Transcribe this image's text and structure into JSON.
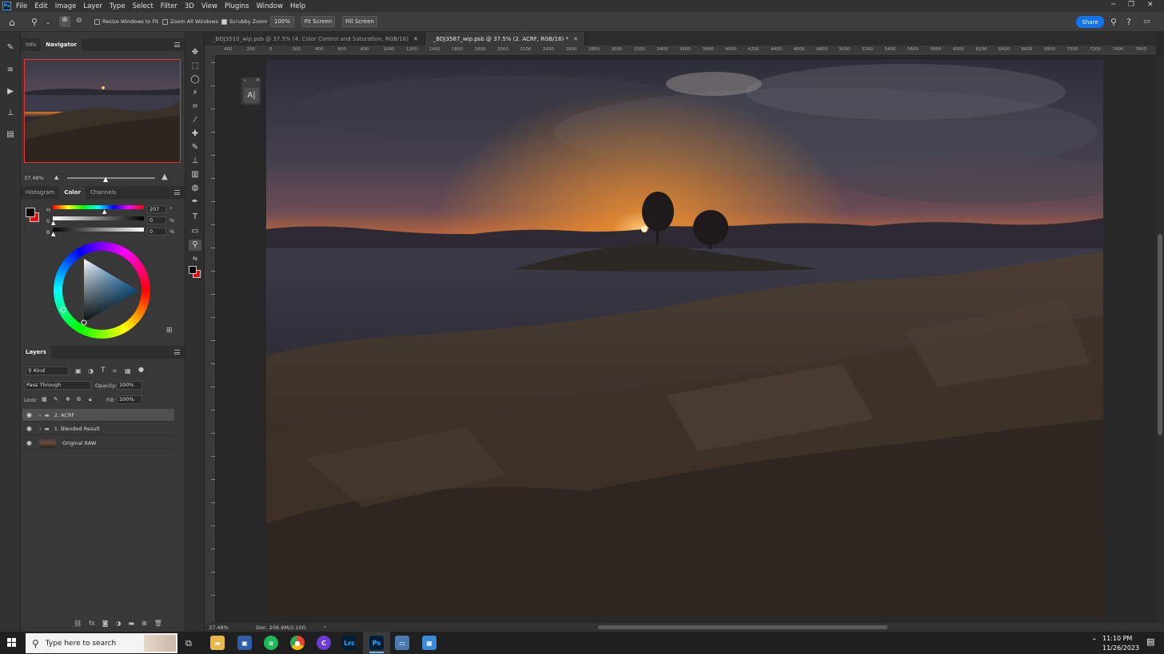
{
  "menubar": {
    "items": [
      "File",
      "Edit",
      "Image",
      "Layer",
      "Type",
      "Select",
      "Filter",
      "3D",
      "View",
      "Plugins",
      "Window",
      "Help"
    ],
    "app_icon_label": "Ps"
  },
  "options_bar": {
    "resize_windows_label": "Resize Windows to Fit",
    "zoom_all_label": "Zoom All Windows",
    "scrubby_zoom_label": "Scrubby Zoom",
    "zoom_value": "100%",
    "fit_screen_label": "Fit Screen",
    "fill_screen_label": "Fill Screen",
    "share_label": "Share"
  },
  "navigator": {
    "tabs": [
      "Info",
      "Navigator"
    ],
    "zoom_value": "37.48%"
  },
  "color_panel": {
    "tabs": [
      "Histogram",
      "Color",
      "Channels"
    ],
    "h_label": "H",
    "s_label": "S",
    "b_label": "B",
    "h_value": "207",
    "s_value": "0",
    "b_value": "0",
    "h_unit": "°",
    "s_unit": "%",
    "b_unit": "%"
  },
  "layers_panel": {
    "title": "Layers",
    "filter_kind": "Kind",
    "blend_mode": "Pass Through",
    "opacity_label": "Opacity:",
    "opacity_value": "100%",
    "lock_label": "Lock:",
    "fill_label": "Fill:",
    "fill_value": "100%",
    "layers": [
      {
        "name": "2. ACRF",
        "type": "group"
      },
      {
        "name": "1. Blended Result",
        "type": "group"
      },
      {
        "name": "Original RAW",
        "type": "image"
      }
    ]
  },
  "documents": {
    "tabs": [
      {
        "title": "_BDJ3510_wip.psb @ 37.5% (4. Color Control and Saturation, RGB/16)"
      },
      {
        "title": "_BDJ3587_wip.psb @ 37.5% (2. ACRF, RGB/16) *"
      }
    ]
  },
  "ruler": {
    "h_ticks": [
      "400",
      "200",
      "0",
      "200",
      "400",
      "600",
      "800",
      "1000",
      "1200",
      "1400",
      "1600",
      "1800",
      "2000",
      "2200",
      "2400",
      "2600",
      "2800",
      "3000",
      "3200",
      "3400",
      "3600",
      "3800",
      "4000",
      "4200",
      "4400",
      "4600",
      "4800",
      "5000",
      "5200",
      "5400",
      "5600",
      "5800",
      "6000",
      "6200",
      "6400",
      "6600",
      "6800",
      "7000",
      "7200",
      "7400",
      "7600"
    ]
  },
  "status": {
    "zoom": "37.48%",
    "doc_size": "Doc: 206.9M/2.10G"
  },
  "taskbar": {
    "search_placeholder": "Type here to search",
    "time": "11:10 PM",
    "date": "11/26/2023",
    "apps": [
      "File Explorer",
      "Lightroom",
      "Spotify",
      "Chrome",
      "Cursor",
      "Lrc",
      "Ps",
      "Computer",
      "Calculator"
    ]
  },
  "colors": {
    "accent": "#1473e6",
    "foreground_swatch": "#000000",
    "background_swatch": "#e01010"
  }
}
